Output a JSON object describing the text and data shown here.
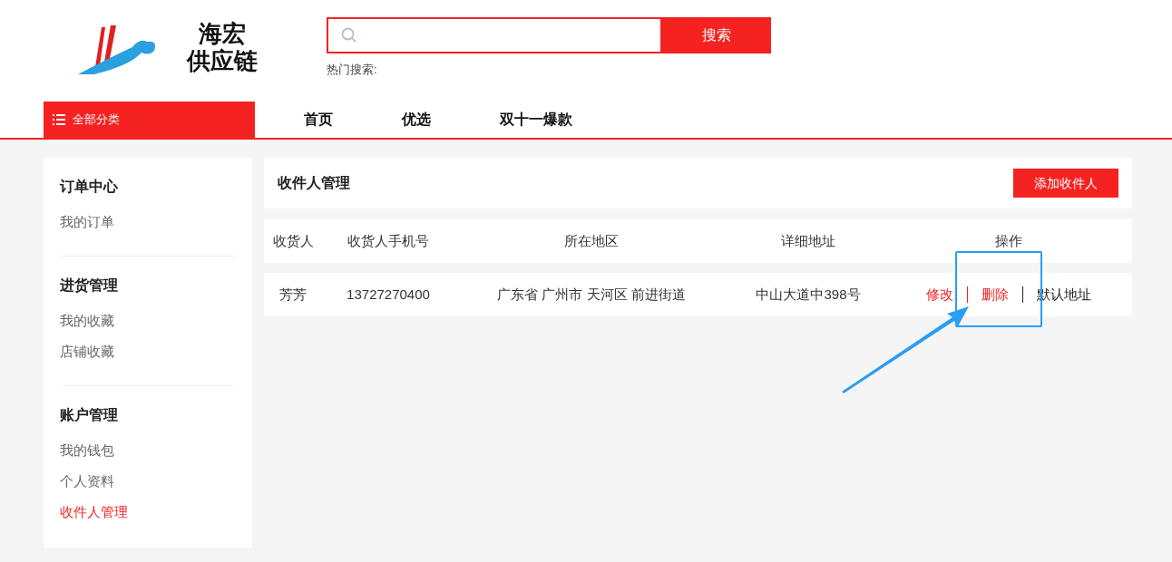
{
  "logo": {
    "line_1": "海宏",
    "line_2": "供应链"
  },
  "search": {
    "button": "搜索",
    "hot_label": "热门搜索:"
  },
  "nav": {
    "categories": "全部分类",
    "items": [
      {
        "label": "首页"
      },
      {
        "label": "优选"
      },
      {
        "label": "双十一爆款"
      }
    ]
  },
  "sidebar": {
    "groups": [
      {
        "title": "订单中心",
        "items": [
          {
            "label": "我的订单",
            "selected": false
          }
        ]
      },
      {
        "title": "进货管理",
        "items": [
          {
            "label": "我的收藏",
            "selected": false
          },
          {
            "label": "店铺收藏",
            "selected": false
          }
        ]
      },
      {
        "title": "账户管理",
        "items": [
          {
            "label": "我的钱包",
            "selected": false
          },
          {
            "label": "个人资料",
            "selected": false
          },
          {
            "label": "收件人管理",
            "selected": true
          }
        ]
      }
    ]
  },
  "panel": {
    "title": "收件人管理",
    "add_button": "添加收件人"
  },
  "table": {
    "columns": [
      "收货人",
      "收货人手机号",
      "所在地区",
      "详细地址",
      "操作"
    ],
    "rows": [
      {
        "name": "芳芳",
        "phone": "13727270400",
        "region": "广东省 广州市 天河区 前进街道",
        "address": "中山大道中398号",
        "actions": [
          {
            "label": "修改",
            "color": "#f52222"
          },
          {
            "label": "删除",
            "color": "#f52222"
          },
          {
            "label": "默认地址",
            "color": "#222222"
          }
        ]
      }
    ]
  }
}
